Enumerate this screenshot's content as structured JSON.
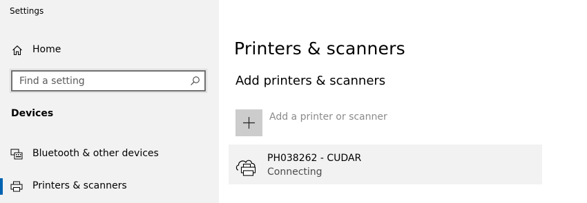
{
  "window": {
    "title": "Settings"
  },
  "sidebar": {
    "home_label": "Home",
    "search": {
      "placeholder": "Find a setting",
      "value": ""
    },
    "section_heading": "Devices",
    "items": [
      {
        "label": "Bluetooth & other devices",
        "icon": "bluetooth-devices-icon",
        "selected": false
      },
      {
        "label": "Printers & scanners",
        "icon": "printer-icon",
        "selected": true
      }
    ]
  },
  "main": {
    "page_title": "Printers & scanners",
    "add_section_heading": "Add printers & scanners",
    "add_button_label": "Add a printer or scanner",
    "devices": [
      {
        "name": "PH038262 - CUDAR",
        "status": "Connecting",
        "icon": "network-printer-icon"
      }
    ]
  },
  "colors": {
    "sidebar_bg": "#f2f2f2",
    "accent": "#0063b1",
    "tile_bg": "#f2f2f2",
    "add_button_bg": "#cccccc",
    "muted_text": "#8a8a8a"
  }
}
